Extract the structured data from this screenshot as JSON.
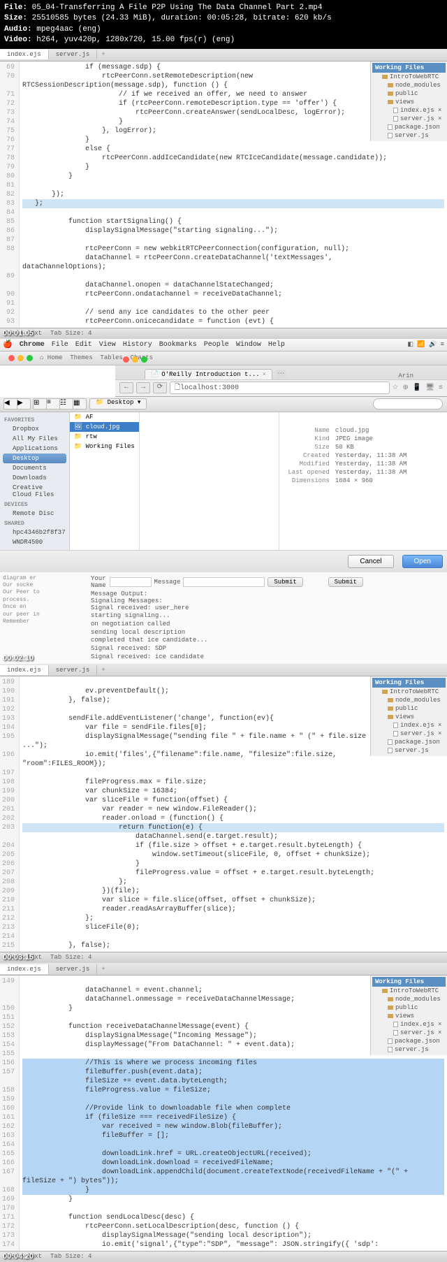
{
  "file_info": {
    "file_label": "File:",
    "file_name": "05_04-Transferring A File P2P Using The Data Channel  Part 2.mp4",
    "size_label": "Size:",
    "size_value": "25510585 bytes (24.33 MiB), duration: 00:05:28, bitrate: 620 kb/s",
    "audio_label": "Audio:",
    "audio_value": "mpeg4aac (eng)",
    "video_label": "Video:",
    "video_value": "h264, yuv420p, 1280x720, 15.00 fps(r) (eng)"
  },
  "timestamps": {
    "t1": "00:01:05",
    "t2": "00:02:10",
    "t3": "00:03:15",
    "t4": "00:04:20"
  },
  "tabs": {
    "index": "index.ejs",
    "server": "server.js"
  },
  "sidebar": {
    "header": "Working Files",
    "project": "IntroToWebRTC",
    "items": [
      "node_modules",
      "public",
      "views",
      "index.ejs",
      "server.js",
      "package.json",
      "server.js"
    ]
  },
  "status": {
    "mode": "Plain Text",
    "tab": "Tab Size: 4"
  },
  "code1": {
    "start": 69,
    "lines": [
      "               if (message.sdp) {",
      "                   rtcPeerConn.setRemoteDescription(new",
      "RTCSessionDescription(message.sdp), function () {",
      "                       // if we received an offer, we need to answer",
      "                       if (rtcPeerConn.remoteDescription.type == 'offer') {",
      "                           rtcPeerConn.createAnswer(sendLocalDesc, logError);",
      "                       }",
      "                   }, logError);",
      "               }",
      "               else {",
      "                   rtcPeerConn.addIceCandidate(new RTCIceCandidate(message.candidate));",
      "               }",
      "           }",
      "",
      "       });",
      "   };",
      "",
      "           function startSignaling() {",
      "               displaySignalMessage(\"starting signaling...\");",
      "",
      "               rtcPeerConn = new webkitRTCPeerConnection(configuration, null);",
      "               dataChannel = rtcPeerConn.createDataChannel('textMessages',",
      "dataChannelOptions);",
      "",
      "               dataChannel.onopen = dataChannelStateChanged;",
      "               rtcPeerConn.ondatachannel = receiveDataChannel;",
      "",
      "               // send any ice candidates to the other peer",
      "               rtcPeerConn.onicecandidate = function (evt) {"
    ],
    "highlight_line": 83
  },
  "menubar": {
    "app": "Chrome",
    "items": [
      "File",
      "Edit",
      "View",
      "History",
      "Bookmarks",
      "People",
      "Window",
      "Help"
    ],
    "user": "Arin"
  },
  "browser": {
    "tab_title": "O'Reilly Introduction t...",
    "url": "localhost:3000"
  },
  "finder": {
    "favorites_label": "FAVORITES",
    "favorites": [
      "Dropbox",
      "All My Files",
      "Applications",
      "Desktop",
      "Documents",
      "Downloads",
      "Creative Cloud Files"
    ],
    "devices_label": "DEVICES",
    "devices": [
      "Remote Disc"
    ],
    "shared_label": "SHARED",
    "shared": [
      "hpc4346b2f8f37",
      "WNDR4500"
    ],
    "selected_sidebar": "Desktop",
    "col1": [
      "AF",
      "cloud.jpg",
      "rtw",
      "Working Files"
    ],
    "selected_file": "cloud.jpg",
    "details": {
      "name_l": "Name",
      "name_v": "cloud.jpg",
      "kind_l": "Kind",
      "kind_v": "JPEG image",
      "size_l": "Size",
      "size_v": "50 KB",
      "created_l": "Created",
      "created_v": "Yesterday, 11:38 AM",
      "modified_l": "Modified",
      "modified_v": "Yesterday, 11:38 AM",
      "opened_l": "Last opened",
      "opened_v": "Yesterday, 11:38 AM",
      "dim_l": "Dimensions",
      "dim_v": "1684 × 960"
    },
    "cancel": "Cancel",
    "open": "Open",
    "path_dropdown": "Desktop"
  },
  "webpage": {
    "name_label": "Your Name",
    "msg_label": "Message",
    "submit": "Submit",
    "output_label": "Message Output:",
    "signal_label": "Signaling Messages:",
    "signals": [
      "Signal received: user_here",
      "starting signaling...",
      "on negotiation called",
      "sending local description",
      "completed that ice candidate...",
      "Signal received: SDP",
      "Signal received: ice candidate"
    ],
    "side_text": [
      "diagram er",
      "Our socke",
      "Our Peer to",
      "process.",
      "Once en",
      "our peer in",
      "Remember"
    ]
  },
  "code2": {
    "start": 189,
    "lines": [
      "",
      "               ev.preventDefault();",
      "           }, false);",
      "",
      "           sendFile.addEventListener('change', function(ev){",
      "               var file = sendFile.files[0];",
      "               displaySignalMessage(\"sending file \" + file.name + \" (\" + file.size + \")",
      "...\");",
      "               io.emit('files',{\"filename\":file.name, \"filesize\":file.size,",
      "\"room\":FILES_ROOM});",
      "",
      "               fileProgress.max = file.size;",
      "               var chunkSize = 16384;",
      "               var sliceFile = function(offset) {",
      "                   var reader = new window.FileReader();",
      "                   reader.onload = (function() {",
      "                       return function(e) {",
      "                           dataChannel.send(e.target.result);",
      "                           if (file.size > offset + e.target.result.byteLength) {",
      "                               window.setTimeout(sliceFile, 0, offset + chunkSize);",
      "                           }",
      "                           fileProgress.value = offset + e.target.result.byteLength;",
      "                       };",
      "                   })(file);",
      "                   var slice = file.slice(offset, offset + chunkSize);",
      "                   reader.readAsArrayBuffer(slice);",
      "               };",
      "               sliceFile(0);",
      "",
      "           }, false);"
    ],
    "highlight_line": 203
  },
  "code3": {
    "start": 149,
    "lines": [
      "",
      "               dataChannel = event.channel;",
      "               dataChannel.onmessage = receiveDataChannelMessage;",
      "           }",
      "",
      "           function receiveDataChannelMessage(event) {",
      "               displaySignalMessage(\"Incoming Message\");",
      "               displayMessage(\"From DataChannel: \" + event.data);",
      "",
      "               //This is where we process incoming files",
      "               fileBuffer.push(event.data);",
      "               fileSize += event.data.byteLength;",
      "               fileProgress.value = fileSize;",
      "",
      "               //Provide link to downloadable file when complete",
      "               if (fileSize === receivedFileSize) {",
      "                   var received = new window.Blob(fileBuffer);",
      "                   fileBuffer = [];",
      "",
      "                   downloadLink.href = URL.createObjectURL(received);",
      "                   downloadLink.download = receivedFileName;",
      "                   downloadLink.appendChild(document.createTextNode(receivedFileName + \"(\" +",
      "fileSize + \") bytes\"));",
      "               }",
      "           }",
      "",
      "           function sendLocalDesc(desc) {",
      "               rtcPeerConn.setLocalDescription(desc, function () {",
      "                   displaySignalMessage(\"sending local description\");",
      "                   io.emit('signal',{\"type\":\"SDP\", \"message\": JSON.stringify({ 'sdp':"
    ],
    "sel_start": 158,
    "sel_end": 171
  }
}
